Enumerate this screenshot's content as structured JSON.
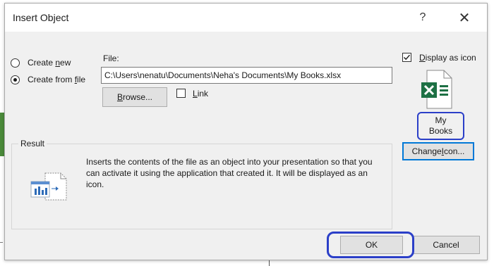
{
  "window": {
    "title": "Insert Object",
    "help_glyph": "?",
    "close_glyph": "✕"
  },
  "options": {
    "create_new": {
      "label_pre": "Create ",
      "label_key": "n",
      "label_post": "ew",
      "checked": false
    },
    "create_from_file": {
      "label_pre": "Create from ",
      "label_key": "f",
      "label_post": "ile",
      "checked": true
    }
  },
  "file": {
    "label": "File:",
    "value": "C:\\Users\\nenatu\\Documents\\Neha's Documents\\My Books.xlsx",
    "browse_pre": "",
    "browse_key": "B",
    "browse_post": "rowse...",
    "link_pre": "",
    "link_key": "L",
    "link_post": "ink",
    "link_checked": false
  },
  "display_as_icon": {
    "label_pre": "",
    "label_key": "D",
    "label_post": "isplay as icon",
    "checked": true,
    "icon_name": "excel-file-icon",
    "caption_line1": "My",
    "caption_line2": "Books",
    "change_icon_pre": "Change ",
    "change_icon_key": "I",
    "change_icon_post": "con..."
  },
  "result": {
    "legend": "Result",
    "icon_name": "embedded-object-icon",
    "text": "Inserts the contents of the file as an object into your presentation so that you can activate it using the application that created it. It will be displayed as an icon."
  },
  "buttons": {
    "ok": "OK",
    "cancel": "Cancel"
  },
  "colors": {
    "highlight": "#2b3fc8",
    "excel_green": "#1d7044",
    "focus_blue": "#0078d7"
  }
}
